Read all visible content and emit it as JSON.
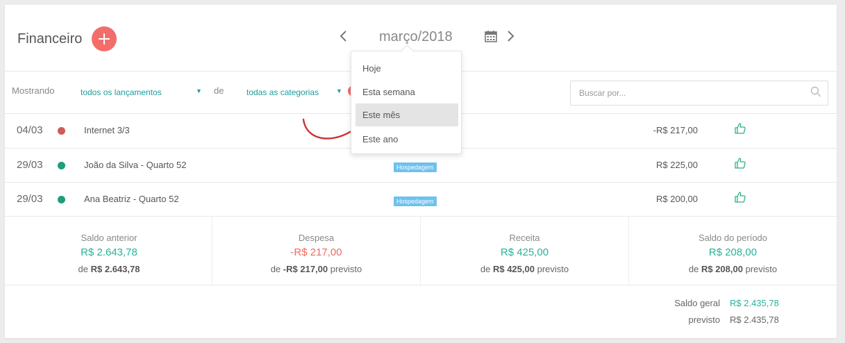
{
  "header": {
    "title": "Financeiro",
    "month": "março/2018"
  },
  "filters": {
    "showing_label": "Mostrando",
    "entries_value": "todos os lançamentos",
    "of_label": "de",
    "categories_value": "todas as categorias",
    "search_placeholder": "Buscar por..."
  },
  "period_menu": {
    "items": [
      {
        "label": "Hoje"
      },
      {
        "label": "Esta semana"
      },
      {
        "label": "Este mês",
        "selected": true
      },
      {
        "label": "Este ano"
      }
    ]
  },
  "entries": [
    {
      "date": "04/03",
      "status_color": "#cd5c5c",
      "description": "Internet 3/3",
      "tag": "",
      "amount": "-R$ 217,00"
    },
    {
      "date": "29/03",
      "status_color": "#1e9e7a",
      "description": "João da Silva - Quarto 52",
      "tag": "Hospedagem",
      "amount": "R$ 225,00"
    },
    {
      "date": "29/03",
      "status_color": "#1e9e7a",
      "description": "Ana Beatriz - Quarto 52",
      "tag": "Hospedagem",
      "amount": "R$ 200,00"
    }
  ],
  "summary": [
    {
      "label": "Saldo anterior",
      "value": "R$ 2.643,78",
      "value_color": "#26b39a",
      "sub_prefix": "de",
      "sub_value": "R$ 2.643,78",
      "sub_suffix": ""
    },
    {
      "label": "Despesa",
      "value": "-R$ 217,00",
      "value_color": "#f06a60",
      "sub_prefix": "de",
      "sub_value": "-R$ 217,00",
      "sub_suffix": "previsto"
    },
    {
      "label": "Receita",
      "value": "R$ 425,00",
      "value_color": "#26b39a",
      "sub_prefix": "de",
      "sub_value": "R$ 425,00",
      "sub_suffix": "previsto"
    },
    {
      "label": "Saldo do período",
      "value": "R$ 208,00",
      "value_color": "#26b39a",
      "sub_prefix": "de",
      "sub_value": "R$ 208,00",
      "sub_suffix": "previsto"
    }
  ],
  "totals": {
    "general_label": "Saldo geral",
    "general_value": "R$ 2.435,78",
    "general_color": "#26b39a",
    "forecast_label": "previsto",
    "forecast_value": "R$ 2.435,78"
  },
  "colors": {
    "accent_red": "#f36d6a",
    "accent_teal": "#1f9b9b",
    "like_green": "#2bb08a",
    "tag_blue": "#6ec1ee"
  },
  "icons": [
    "plus-icon",
    "chevron-left-icon",
    "chevron-right-icon",
    "calendar-icon",
    "search-icon",
    "thumbs-up-icon",
    "caret-down-icon",
    "curved-arrow-annotation"
  ]
}
